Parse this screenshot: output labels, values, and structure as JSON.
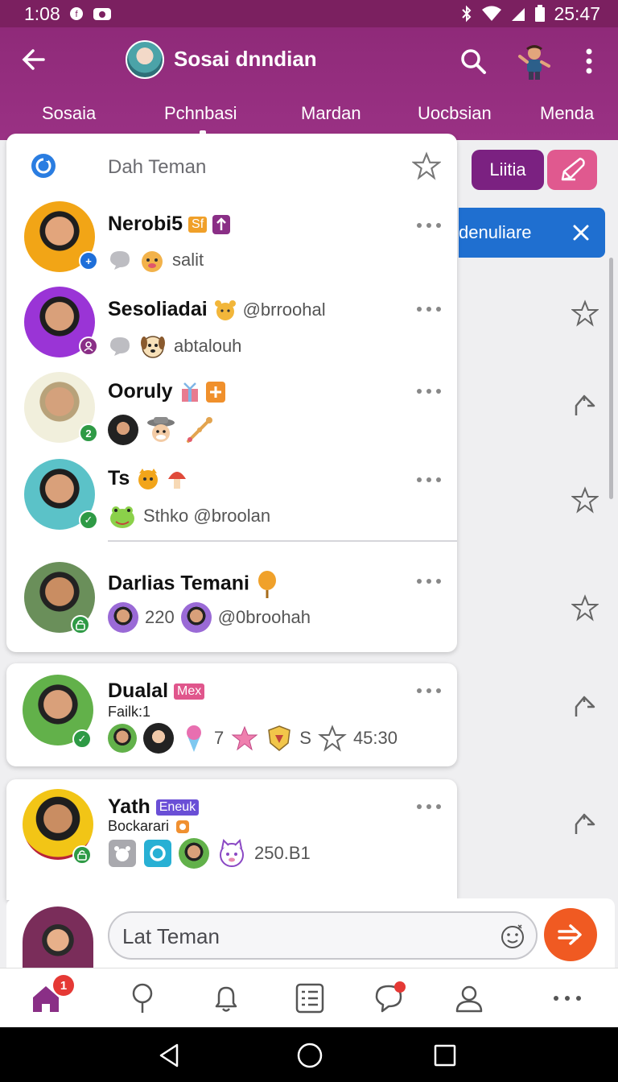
{
  "status": {
    "time": "1:08",
    "clock": "25:47"
  },
  "appbar": {
    "title": "Sosai dnndian"
  },
  "tabs": [
    {
      "label": "Sosaia"
    },
    {
      "label": "Pchnbasi"
    },
    {
      "label": "Mardan"
    },
    {
      "label": "Uocbsian"
    },
    {
      "label": "Menda"
    }
  ],
  "list_header": {
    "title": "Dah Teman"
  },
  "right_panel": {
    "primary_button": "Liitia",
    "banner_text": "denuliare"
  },
  "contacts": [
    {
      "name": "Nerobi5",
      "tag": "Sf",
      "sub_text": "salit",
      "badge": "+"
    },
    {
      "name": "Sesoliadai",
      "handle": "@brroohal",
      "sub_text": "abtalouh",
      "badge": ""
    },
    {
      "name": "Ooruly",
      "sub_text": "",
      "badge": "2"
    },
    {
      "name": "Ts",
      "sub_text": "Sthko @broolan",
      "badge": "✓"
    },
    {
      "name": "Darlias Temani",
      "count": "220",
      "handle": "@0broohah",
      "badge": ""
    }
  ],
  "cards": [
    {
      "name": "Dualal",
      "tag": "Mex",
      "line2": "Failk:1",
      "count": "7",
      "letter": "S",
      "time": "45:30"
    },
    {
      "name": "Yath",
      "tag": "Eneuk",
      "line2": "Bockarari",
      "value": "250.B1"
    }
  ],
  "composer": {
    "placeholder": "Lat Teman"
  },
  "bottom_nav": {
    "home_badge": "1"
  },
  "colors": {
    "appbar": "#9a3184",
    "accent": "#f05a22",
    "banner": "#1f6fd0",
    "primary_button": "#7b2181",
    "edit_button": "#e0598f"
  }
}
